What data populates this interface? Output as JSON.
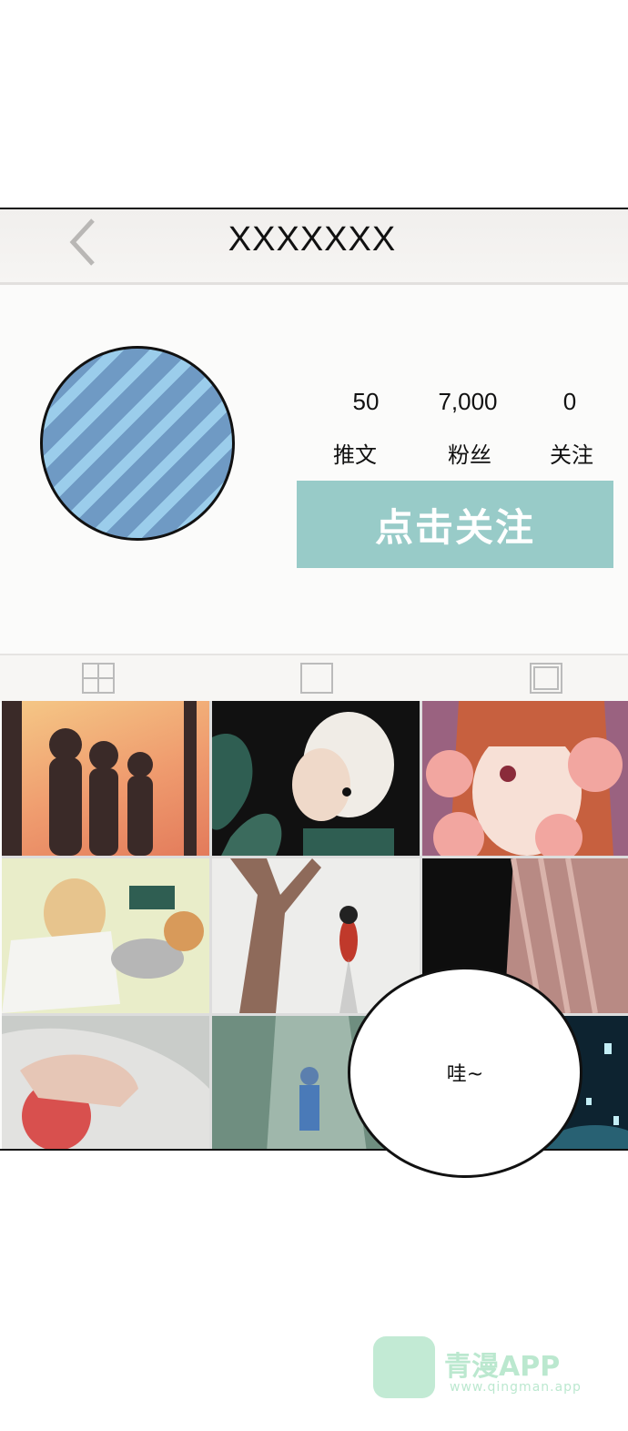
{
  "header": {
    "title": "XXXXXXX",
    "back_icon": "chevron-left-icon"
  },
  "profile": {
    "stats": [
      {
        "value": "50",
        "label": "推文"
      },
      {
        "value": "7,000",
        "label": "粉丝"
      },
      {
        "value": "0",
        "label": "关注"
      }
    ],
    "follow_button": "点击关注",
    "follow_color": "#98cbc8"
  },
  "tabs": [
    "grid-icon",
    "square-icon",
    "framed-square-icon"
  ],
  "bubble": {
    "text": "哇~"
  },
  "watermark": {
    "name": "青漫APP",
    "url": "www.qingman.app"
  }
}
